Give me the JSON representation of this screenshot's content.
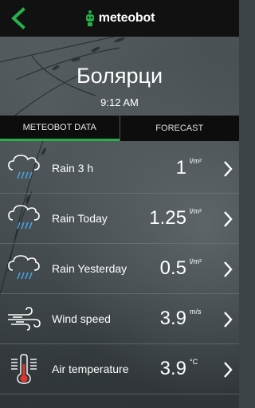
{
  "app": {
    "logo_text": "meteobot",
    "accent": "#27b04a"
  },
  "header": {
    "location": "Болярци",
    "time": "9:12 AM"
  },
  "tabs": [
    {
      "label": "METEOBOT DATA",
      "active": true
    },
    {
      "label": "FORECAST",
      "active": false
    }
  ],
  "rows": [
    {
      "icon": "rain-cloud-icon",
      "label": "Rain 3 h",
      "value": "1",
      "unit": "l/m²"
    },
    {
      "icon": "rain-cloud-icon",
      "label": "Rain Today",
      "value": "1.25",
      "unit": "l/m²"
    },
    {
      "icon": "rain-cloud-icon",
      "label": "Rain Yesterday",
      "value": "0.5",
      "unit": "l/m²"
    },
    {
      "icon": "wind-icon",
      "label": "Wind speed",
      "value": "3.9",
      "unit": "m/s"
    },
    {
      "icon": "thermometer-icon",
      "label": "Air temperature",
      "value": "3.9",
      "unit": "°C"
    }
  ]
}
